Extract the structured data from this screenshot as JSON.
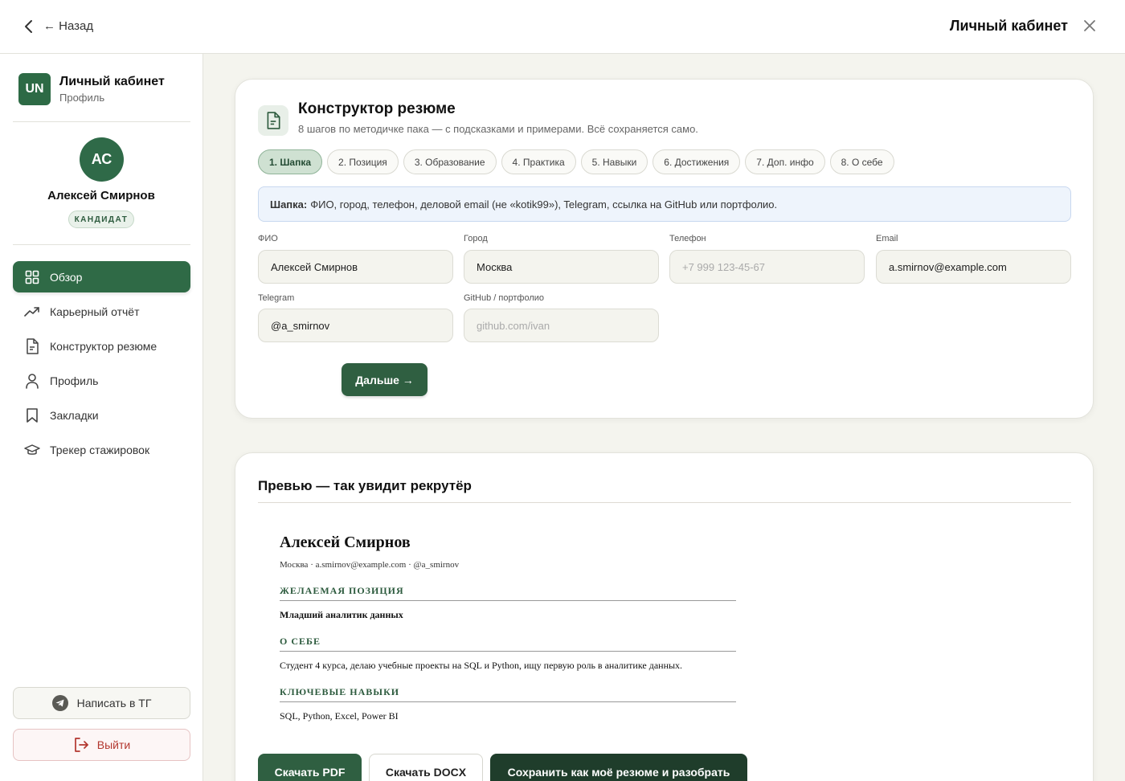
{
  "topbar": {
    "back_label": "← Назад",
    "title": "Личный кабинет",
    "back_icon": "chevron-left-icon",
    "close_icon": "close-icon"
  },
  "sidebar": {
    "brand": {
      "logo": "UN",
      "title": "Личный кабинет",
      "subtitle": "Профиль"
    },
    "user": {
      "initials": "АС",
      "name": "Алексей Смирнов",
      "role": "КАНДИДАТ"
    },
    "items": [
      {
        "label": "Обзор",
        "icon": "grid-icon",
        "active": true
      },
      {
        "label": "Карьерный отчёт",
        "icon": "trend-up-icon",
        "active": false
      },
      {
        "label": "Конструктор резюме",
        "icon": "document-icon",
        "active": false
      },
      {
        "label": "Профиль",
        "icon": "user-icon",
        "active": false
      },
      {
        "label": "Закладки",
        "icon": "bookmark-icon",
        "active": false
      },
      {
        "label": "Трекер стажировок",
        "icon": "graduation-cap-icon",
        "active": false
      }
    ],
    "tg_button": "Написать в ТГ",
    "logout_button": "Выйти"
  },
  "builder": {
    "title": "Конструктор резюме",
    "subtitle": "8 шагов по методичке пака — с подсказками и примерами. Всё сохраняется само.",
    "steps": [
      {
        "label": "1. Шапка",
        "active": true
      },
      {
        "label": "2. Позиция",
        "active": false
      },
      {
        "label": "3. Образование",
        "active": false
      },
      {
        "label": "4. Практика",
        "active": false
      },
      {
        "label": "5. Навыки",
        "active": false
      },
      {
        "label": "6. Достижения",
        "active": false
      },
      {
        "label": "7. Доп. инфо",
        "active": false
      },
      {
        "label": "8. О себе",
        "active": false
      }
    ],
    "hint_title": "Шапка:",
    "hint_text": "ФИО, город, телефон, деловой email (не «kotik99»), Telegram, ссылка на GitHub или портфолио.",
    "fields": {
      "fio": {
        "label": "ФИО",
        "value": "Алексей Смирнов",
        "placeholder": ""
      },
      "city": {
        "label": "Город",
        "value": "Москва",
        "placeholder": ""
      },
      "phone": {
        "label": "Телефон",
        "value": "",
        "placeholder": "+7 999 123-45-67"
      },
      "email": {
        "label": "Email",
        "value": "a.smirnov@example.com",
        "placeholder": ""
      },
      "telegram": {
        "label": "Telegram",
        "value": "@a_smirnov",
        "placeholder": ""
      },
      "github": {
        "label": "GitHub / портфолио",
        "value": "",
        "placeholder": "github.com/ivan"
      }
    },
    "next_button": "Дальше →"
  },
  "preview": {
    "title": "Превью — так увидит рекрутёр",
    "resume": {
      "name": "Алексей Смирнов",
      "contacts": "Москва · a.smirnov@example.com · @a_smirnov",
      "sections": [
        {
          "heading": "ЖЕЛАЕМАЯ ПОЗИЦИЯ",
          "text": "Младший аналитик данных"
        },
        {
          "heading": "О СЕБЕ",
          "text": "Студент 4 курса, делаю учебные проекты на SQL и Python, ищу первую роль в аналитике данных."
        },
        {
          "heading": "КЛЮЧЕВЫЕ НАВЫКИ",
          "text": "SQL, Python, Excel, Power BI"
        }
      ]
    },
    "buttons": {
      "pdf": "Скачать PDF",
      "docx": "Скачать DOCX",
      "save": "Сохранить как моё резюме и разобрать"
    }
  }
}
